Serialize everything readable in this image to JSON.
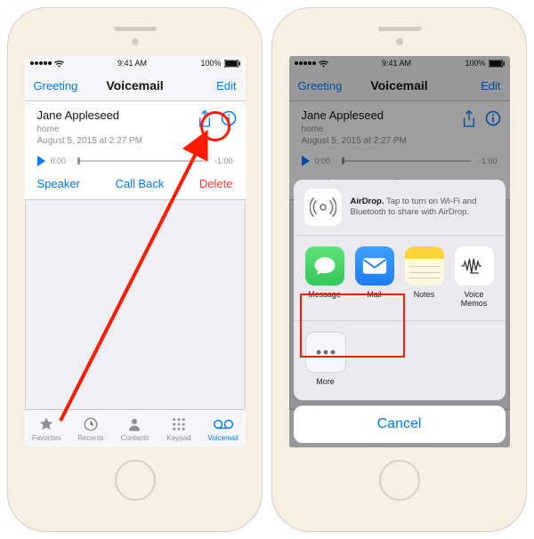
{
  "status": {
    "carrier_dots": 5,
    "wifi": "wifi-icon",
    "time": "9:41 AM",
    "battery_pct": "100%"
  },
  "nav": {
    "left": "Greeting",
    "title": "Voicemail",
    "right": "Edit"
  },
  "voicemail": {
    "name": "Jane Appleseed",
    "label": "home",
    "date": "August 5, 2015 at 2:27 PM",
    "elapsed": "0:00",
    "remaining": "-1:00",
    "actions": {
      "speaker": "Speaker",
      "callback": "Call Back",
      "delete": "Delete"
    }
  },
  "tabs": {
    "favorites": "Favorites",
    "recents": "Recents",
    "contacts": "Contacts",
    "keypad": "Keypad",
    "voicemail": "Voicemail"
  },
  "share": {
    "airdrop_bold": "AirDrop.",
    "airdrop_text": " Tap to turn on Wi-Fi and Bluetooth to share with AirDrop.",
    "apps": {
      "message": "Message",
      "mail": "Mail",
      "notes": "Notes",
      "voicememos": "Voice Memos"
    },
    "more": "More",
    "cancel": "Cancel"
  },
  "colors": {
    "tint": "#007aff",
    "destructive": "#ff3b30",
    "messages": "#34c759",
    "mail": "#1f7cf1",
    "notes_top": "#ffd43b",
    "notes_bottom": "#fff8e1"
  }
}
